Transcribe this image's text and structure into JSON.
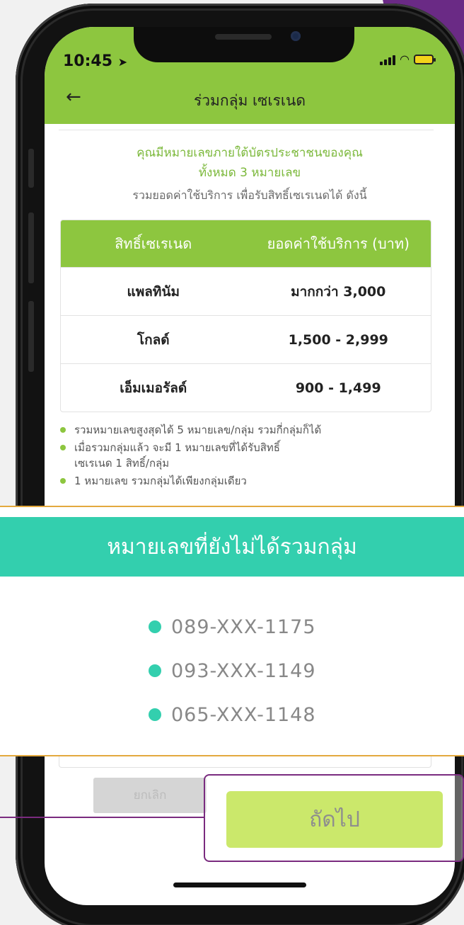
{
  "status_bar": {
    "time": "10:45"
  },
  "header": {
    "title": "ร่วมกลุ่ม เซเรเนด"
  },
  "intro": {
    "line1": "คุณมีหมายเลขภายใต้บัตรประชาชนของคุณ",
    "line2": "ทั้งหมด 3 หมายเลข",
    "line3": "รวมยอดค่าใช้บริการ เพื่อรับสิทธิ์เซเรเนดได้ ดังนี้"
  },
  "tier_table": {
    "headers": [
      "สิทธิ์เซเรเนด",
      "ยอดค่าใช้บริการ (บาท)"
    ],
    "rows": [
      [
        "แพลทินัม",
        "มากกว่า 3,000"
      ],
      [
        "โกลด์",
        "1,500 - 2,999"
      ],
      [
        "เอ็มเมอรัลด์",
        "900 - 1,499"
      ]
    ]
  },
  "rules": [
    "รวมหมายเลขสูงสุดได้ 5 หมายเลข/กลุ่ม รวมกี่กลุ่มก็ได้",
    "เมื่อรวมกลุ่มแล้ว จะมี 1 หมายเลขที่ได้รับสิทธิ์",
    "เซเรเนด 1 สิทธิ์/กลุ่ม",
    "1 หมายเลข รวมกลุ่มได้เพียงกลุ่มเดียว"
  ],
  "callout": {
    "title": "หมายเลขที่ยังไม่ได้รวมกลุ่ม",
    "numbers": [
      "089-XXX-1175",
      "093-XXX-1149",
      "065-XXX-1148"
    ]
  },
  "buttons": {
    "cancel": "ยกเลิก",
    "next": "ถัดไป"
  },
  "colors": {
    "brand_green": "#8dc63f",
    "callout_teal": "#33cfae",
    "accent_purple": "#7a2b7f",
    "next_button": "#cbe86b"
  }
}
